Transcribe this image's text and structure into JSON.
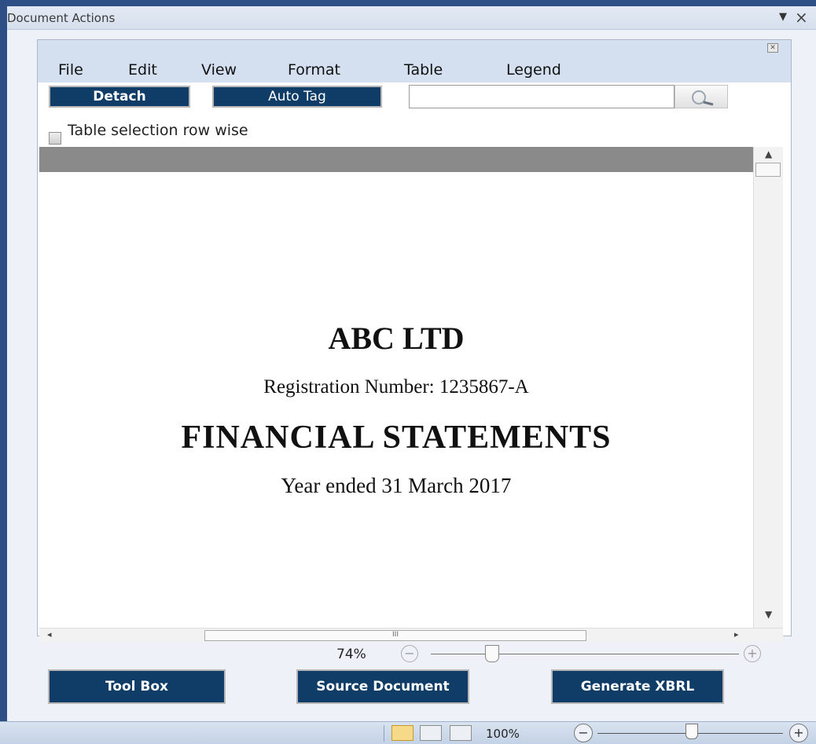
{
  "pane": {
    "title": "Document Actions",
    "menu_icon": "dropdown-arrow-icon",
    "close_icon": "close-icon"
  },
  "menu": {
    "items": [
      "File",
      "Edit",
      "View",
      "Format",
      "Table",
      "Legend"
    ]
  },
  "toolbar": {
    "detach_label": "Detach",
    "autotag_label": "Auto Tag",
    "search_value": "",
    "search_icon": "search-icon"
  },
  "options": {
    "row_wise_label": "Table selection row wise",
    "row_wise_checked": false
  },
  "document": {
    "company": "ABC LTD",
    "registration": "Registration Number: 1235867-A",
    "heading": "FINANCIAL STATEMENTS",
    "year": "Year ended 31 March 2017"
  },
  "hscroll": {
    "grip": "III"
  },
  "zoom": {
    "level": "74%",
    "percent": 74
  },
  "footer": {
    "toolbox_label": "Tool Box",
    "source_label": "Source Document",
    "xbrl_label": "Generate XBRL"
  },
  "statusbar": {
    "zoom_level": "100%",
    "percent": 100
  },
  "colors": {
    "accent_blue": "#0f3d68",
    "frame_blue": "#2e4f86"
  }
}
